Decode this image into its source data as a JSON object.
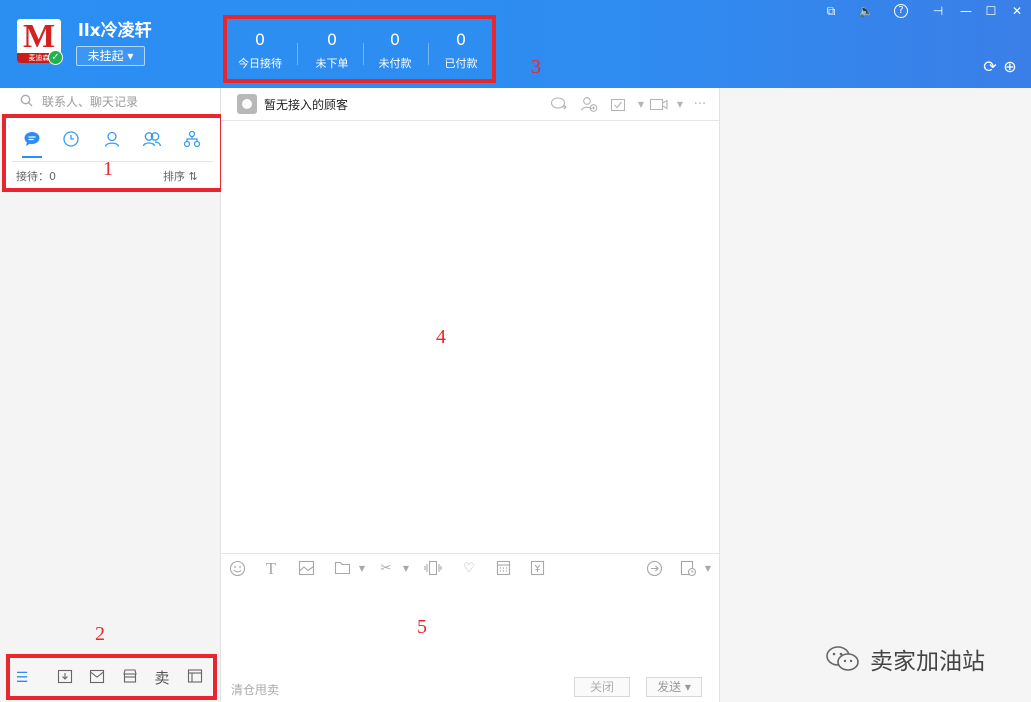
{
  "header": {
    "logo_mark": "M",
    "logo_band_text": "麦迪森",
    "username": "llx冷凌轩",
    "status_button": "未挂起 ▾",
    "stats": [
      {
        "value": "0",
        "label": "今日接待"
      },
      {
        "value": "0",
        "label": "未下单"
      },
      {
        "value": "0",
        "label": "未付款"
      },
      {
        "value": "0",
        "label": "已付款"
      }
    ]
  },
  "window_controls": [
    "⧉",
    "🔈",
    "?",
    "⊣",
    "—",
    "☐",
    "✕"
  ],
  "header_icons": [
    "refresh-icon",
    "add-icon"
  ],
  "search": {
    "placeholder": "联系人、聊天记录"
  },
  "left_tabs": [
    "chat-bubble-icon",
    "clock-icon",
    "person-icon",
    "group-icon",
    "org-icon"
  ],
  "left_status": {
    "reception": "接待：0",
    "sort": "排序 ⇅"
  },
  "bottom_icons": [
    "menu-icon",
    "import-icon",
    "mail-icon",
    "shop-icon",
    "卖",
    "window-icon"
  ],
  "chat": {
    "title": "暂无接入的顾客",
    "header_icons": [
      "transfer-icon",
      "add-person-icon",
      "evaluate-icon",
      "video-icon",
      "more-icon"
    ],
    "toolbar_icons": [
      "emoji-icon",
      "text-icon",
      "image-icon",
      "folder-icon",
      "scissors-icon",
      "shake-icon",
      "heart-icon",
      "calculator-icon",
      "coupon-icon",
      "message-icon",
      "history-icon"
    ],
    "quick_phrase": "清仓甩卖",
    "close_label": "关闭",
    "send_label": "发送 ▾"
  },
  "annotations": [
    "1",
    "2",
    "3",
    "4",
    "5"
  ],
  "watermark": {
    "text": "卖家加油站"
  },
  "colors": {
    "header_blue": "#2f8cf0",
    "annotation_red": "#e8262d",
    "tab_blue": "#3a9cf0"
  }
}
